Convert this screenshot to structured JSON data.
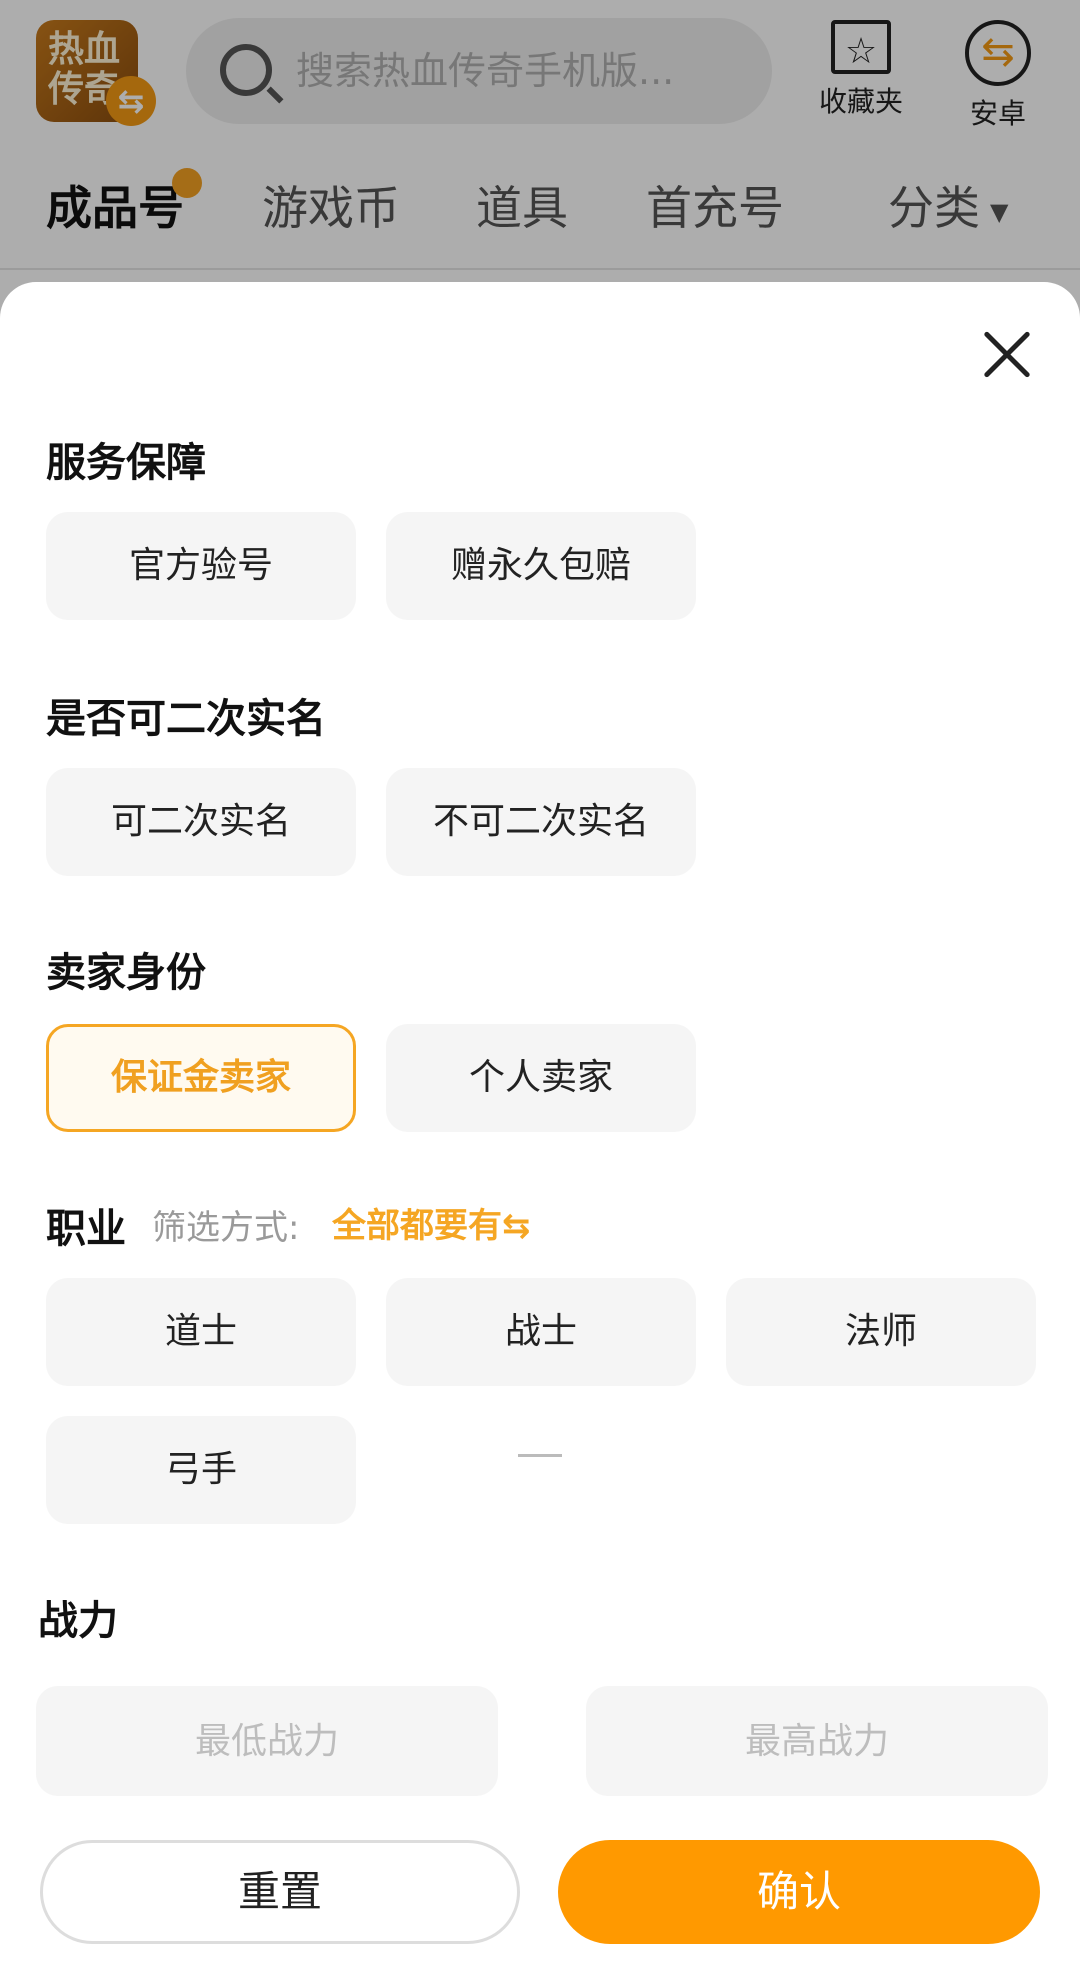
{
  "header": {
    "logo_text": "热血传奇",
    "search_placeholder": "搜索热血传奇手机版...",
    "favorites_label": "收藏夹",
    "platform_label": "安卓"
  },
  "tabs": [
    "成品号",
    "游戏币",
    "道具",
    "首充号",
    "分类"
  ],
  "filters": {
    "service": {
      "title": "服务保障",
      "options": [
        "官方验号",
        "赠永久包赔"
      ]
    },
    "realname": {
      "title": "是否可二次实名",
      "options": [
        "可二次实名",
        "不可二次实名"
      ]
    },
    "seller": {
      "title": "卖家身份",
      "options": [
        "保证金卖家",
        "个人卖家"
      ],
      "selected": "保证金卖家"
    },
    "job": {
      "title": "职业",
      "mode_label": "筛选方式:",
      "mode_value": "全部都要有⇆",
      "options": [
        "道士",
        "战士",
        "法师",
        "弓手"
      ]
    },
    "power": {
      "title": "战力",
      "min_placeholder": "最低战力",
      "max_placeholder": "最高战力"
    }
  },
  "actions": {
    "reset": "重置",
    "confirm": "确认"
  },
  "colors": {
    "accent": "#f5a623",
    "confirm_bg": "#ff9900"
  }
}
